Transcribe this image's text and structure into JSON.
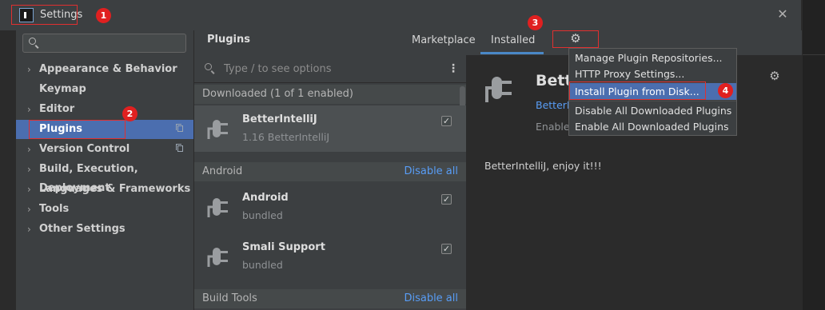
{
  "window": {
    "title": "Settings",
    "close_icon": "close-icon"
  },
  "sidebar": {
    "search_placeholder": "",
    "items": [
      {
        "label": "Appearance & Behavior",
        "expandable": true
      },
      {
        "label": "Keymap",
        "expandable": false
      },
      {
        "label": "Editor",
        "expandable": true
      },
      {
        "label": "Plugins",
        "expandable": false,
        "selected": true
      },
      {
        "label": "Version Control",
        "expandable": true
      },
      {
        "label": "Build, Execution, Deployment",
        "expandable": true
      },
      {
        "label": "Languages & Frameworks",
        "expandable": true
      },
      {
        "label": "Tools",
        "expandable": true
      },
      {
        "label": "Other Settings",
        "expandable": true
      }
    ]
  },
  "header": {
    "title": "Plugins",
    "tabs": [
      {
        "label": "Marketplace",
        "active": false
      },
      {
        "label": "Installed",
        "active": true
      }
    ],
    "gear_icon": "gear-icon"
  },
  "plugin_list": {
    "search_placeholder": "Type / to see options",
    "sections": [
      {
        "name": "Downloaded (1 of 1 enabled)",
        "action": "",
        "plugins": [
          {
            "name": "BetterIntelliJ",
            "meta": "1.16  BetterIntelliJ",
            "checked": true,
            "selected": true
          }
        ]
      },
      {
        "name": "Android",
        "action": "Disable all",
        "plugins": [
          {
            "name": "Android",
            "meta": "bundled",
            "checked": true
          },
          {
            "name": "Smali Support",
            "meta": "bundled",
            "checked": true
          }
        ]
      },
      {
        "name": "Build Tools",
        "action": "Disable all",
        "plugins": []
      }
    ]
  },
  "detail": {
    "name": "Bette",
    "link": "BetterIn",
    "status": "Enable",
    "description": "BetterIntelliJ, enjoy it!!!"
  },
  "dropdown_menu": {
    "items": [
      {
        "label": "Manage Plugin Repositories..."
      },
      {
        "label": "HTTP Proxy Settings..."
      },
      {
        "label": "Install Plugin from Disk...",
        "highlighted": true
      },
      {
        "label": "Disable All Downloaded Plugins"
      },
      {
        "label": "Enable All Downloaded Plugins"
      }
    ]
  },
  "annotations": [
    "1",
    "2",
    "3",
    "4"
  ],
  "colors": {
    "selection": "#4b6eaf",
    "link": "#589df6",
    "annotation": "#e02020"
  }
}
